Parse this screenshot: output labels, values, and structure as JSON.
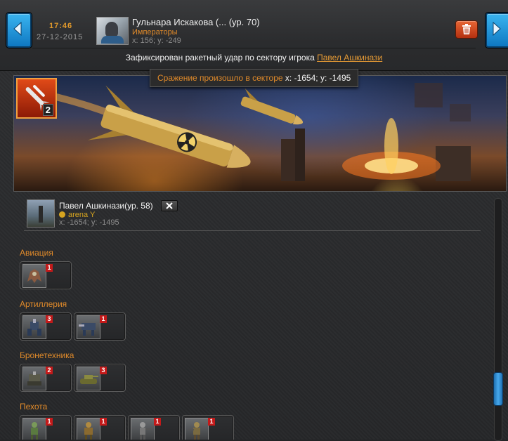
{
  "header": {
    "time": "17:46",
    "date": "27-12-2015",
    "player_name": "Гульнара Искакова (... (ур. 70)",
    "clan": "Императоры",
    "coords": "x: 156; y: -249"
  },
  "message": {
    "text": "Зафиксирован ракетный удар по сектору игрока",
    "link": "Павел Ашкинази"
  },
  "tooltip": {
    "label": "Сражение произошло в секторе",
    "value": "x: -1654; y: -1495"
  },
  "banner": {
    "rocket_count": "2"
  },
  "target": {
    "name": "Павел Ашкинази(ур. 58)",
    "tag": "arena Y",
    "coords": "x: -1654; y: -1495"
  },
  "sections": [
    {
      "title": "Авиация",
      "units": [
        {
          "icon": "aircraft-unit-icon",
          "count": "1"
        }
      ]
    },
    {
      "title": "Артиллерия",
      "units": [
        {
          "icon": "artillery-mech-icon",
          "count": "3"
        },
        {
          "icon": "artillery-walker-icon",
          "count": "1"
        }
      ]
    },
    {
      "title": "Бронетехника",
      "units": [
        {
          "icon": "armored-mech-icon",
          "count": "2"
        },
        {
          "icon": "tank-icon",
          "count": "3"
        }
      ]
    },
    {
      "title": "Пехота",
      "units": [
        {
          "icon": "infantry-mech-icon",
          "count": "1"
        },
        {
          "icon": "infantry-heavy-icon",
          "count": "1"
        },
        {
          "icon": "infantry-soldier-icon",
          "count": "1"
        },
        {
          "icon": "infantry-gunner-icon",
          "count": "1"
        }
      ]
    }
  ],
  "colors": {
    "accent": "#e08a2a",
    "nav_blue": "#1b8fd6",
    "delete_red": "#d04a1c",
    "badge_red": "#c41a1a"
  }
}
